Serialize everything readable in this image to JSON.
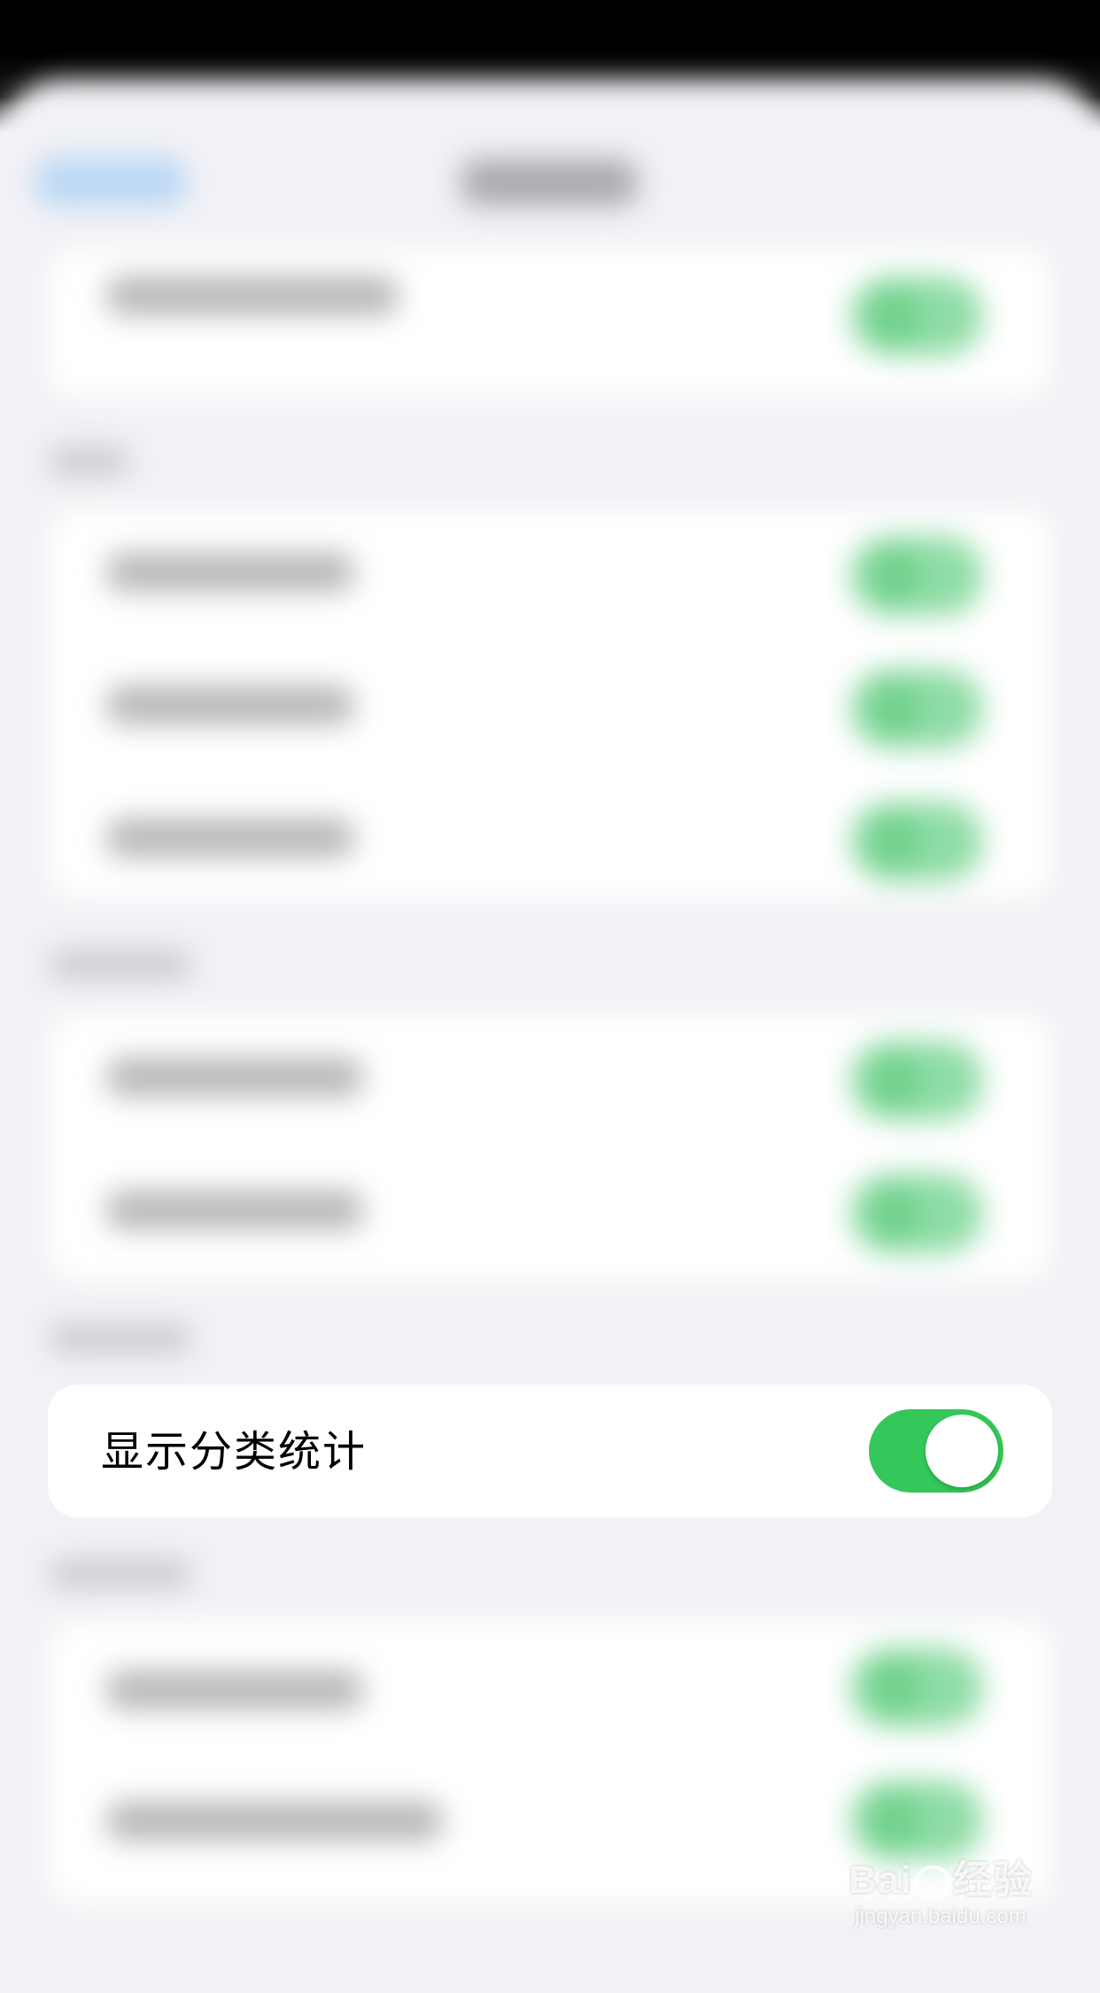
{
  "setting_row": {
    "label": "显示分类统计",
    "toggle_on": true,
    "accent_color": "#34c759"
  },
  "watermark": {
    "brand_left": "Bai",
    "brand_right": "经验",
    "url": "jingyan.baidu.com"
  },
  "icons": {
    "paw": "baidu-paw-icon"
  }
}
